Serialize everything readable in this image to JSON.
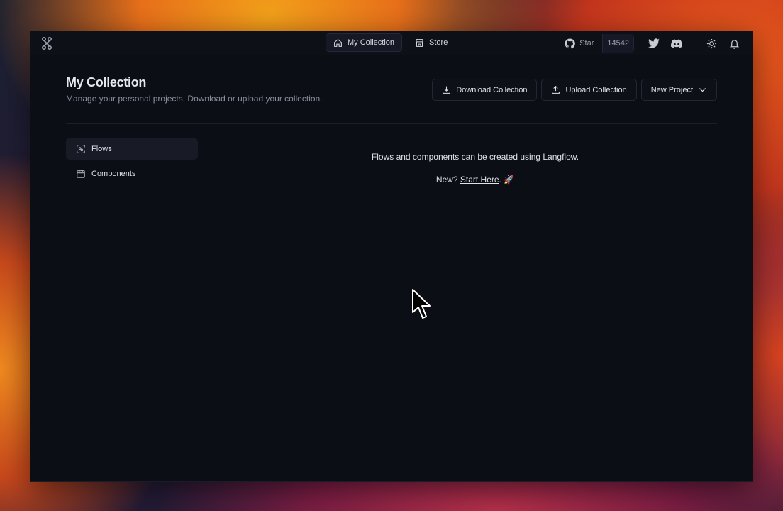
{
  "topbar": {
    "nav": [
      {
        "label": "My Collection",
        "icon": "home-icon",
        "active": true
      },
      {
        "label": "Store",
        "icon": "store-icon",
        "active": false
      }
    ],
    "star_label": "Star",
    "star_count": "14542"
  },
  "header": {
    "title": "My Collection",
    "subtitle": "Manage your personal projects. Download or upload your collection."
  },
  "actions": {
    "download_label": "Download Collection",
    "upload_label": "Upload Collection",
    "new_project_label": "New Project"
  },
  "sidebar": {
    "items": [
      {
        "label": "Flows",
        "icon": "flows-icon",
        "active": true
      },
      {
        "label": "Components",
        "icon": "components-icon",
        "active": false
      }
    ]
  },
  "empty_state": {
    "line1": "Flows and components can be created using Langflow.",
    "prefix": "New? ",
    "link": "Start Here",
    "suffix": ". 🚀"
  }
}
